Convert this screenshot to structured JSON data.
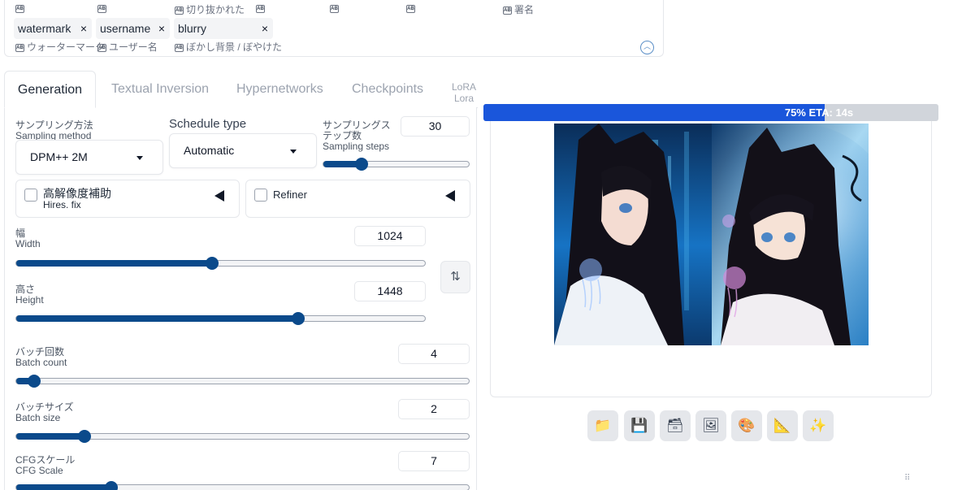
{
  "negative_prompt": {
    "top_translations": [
      "",
      "",
      "切り抜かれた",
      "",
      "",
      "",
      "署名"
    ],
    "tags": [
      {
        "text": "watermark",
        "translation": "ウォーターマーク"
      },
      {
        "text": "username",
        "translation": "ユーザー名"
      },
      {
        "text": "blurry",
        "translation": "ぼかし背景 / ぼやけた"
      }
    ],
    "remove_symbol": "×",
    "collapse_icon": "chevron-up-icon"
  },
  "tabs": [
    {
      "label": "Generation",
      "active": true
    },
    {
      "label": "Textual Inversion",
      "active": false
    },
    {
      "label": "Hypernetworks",
      "active": false
    },
    {
      "label": "Checkpoints",
      "active": false
    },
    {
      "label": "LoRA",
      "label2": "Lora",
      "active": false
    }
  ],
  "sampling_method": {
    "label_jp": "サンプリング方法",
    "label_en": "Sampling method",
    "value": "DPM++ 2M"
  },
  "schedule_type": {
    "label": "Schedule type",
    "value": "Automatic"
  },
  "sampling_steps": {
    "label_jp": "サンプリングステップ数",
    "label_en": "Sampling steps",
    "value": "30",
    "fraction": 0.26
  },
  "hires_fix": {
    "label_jp": "高解像度補助",
    "label_en": "Hires. fix",
    "checked": false
  },
  "refiner": {
    "label": "Refiner",
    "checked": false
  },
  "width": {
    "label_jp": "幅",
    "label_en": "Width",
    "value": "1024",
    "fraction": 0.48
  },
  "height": {
    "label_jp": "高さ",
    "label_en": "Height",
    "value": "1448",
    "fraction": 0.69
  },
  "batch_count": {
    "label_jp": "バッチ回数",
    "label_en": "Batch count",
    "value": "4",
    "fraction": 0.04
  },
  "batch_size": {
    "label_jp": "バッチサイズ",
    "label_en": "Batch size",
    "value": "2",
    "fraction": 0.15
  },
  "cfg_scale": {
    "label_jp": "CFGスケール",
    "label_en": "CFG Scale",
    "value": "7",
    "fraction": 0.21
  },
  "swap_icon": "swap-dimensions-icon",
  "progress": {
    "text": "75% ETA: 14s",
    "fraction": 0.75
  },
  "toolbar": [
    {
      "icon": "folder-icon",
      "glyph": "📁"
    },
    {
      "icon": "save-icon",
      "glyph": "💾"
    },
    {
      "icon": "zip-icon",
      "glyph": "🗃"
    },
    {
      "icon": "send-to-img2img-icon",
      "glyph": "🖼"
    },
    {
      "icon": "send-to-inpaint-icon",
      "glyph": "🎨"
    },
    {
      "icon": "send-to-extras-icon",
      "glyph": "📐"
    },
    {
      "icon": "sparkle-icon",
      "glyph": "✨"
    }
  ],
  "colors": {
    "accent": "#0b4a8b",
    "progress": "#1a56db",
    "border": "#e5e7eb"
  }
}
